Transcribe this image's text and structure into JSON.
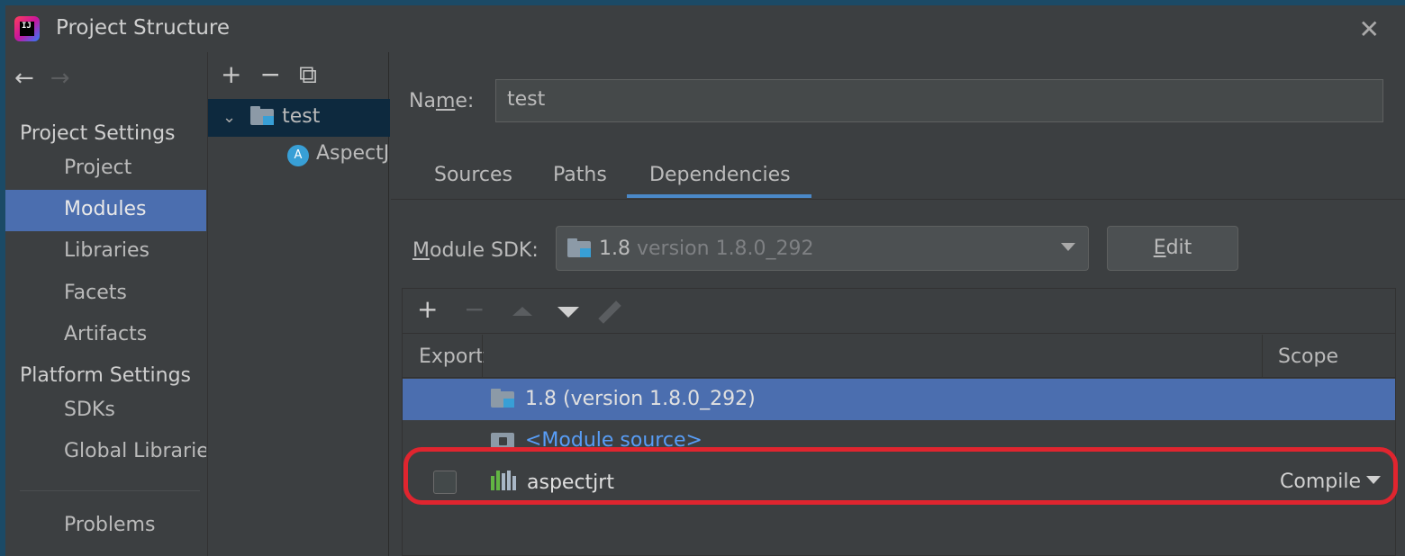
{
  "window": {
    "title": "Project Structure",
    "app_icon_text": "IJ"
  },
  "nav": {
    "project_settings_header": "Project Settings",
    "project_items": [
      "Project",
      "Modules",
      "Libraries",
      "Facets",
      "Artifacts"
    ],
    "platform_settings_header": "Platform Settings",
    "platform_items": [
      "SDKs",
      "Global Librarie"
    ],
    "problems": "Problems",
    "selected": "Modules"
  },
  "tree": {
    "root": "test",
    "child": "AspectJ"
  },
  "module": {
    "name_label": "Name:",
    "name_value": "test",
    "tabs": [
      "Sources",
      "Paths",
      "Dependencies"
    ],
    "active_tab": "Dependencies",
    "sdk_label": "Module SDK:",
    "sdk_value": "1.8",
    "sdk_version": "version 1.8.0_292",
    "edit_label": "Edit"
  },
  "dependencies": {
    "columns": {
      "export": "Export",
      "scope": "Scope"
    },
    "rows": [
      {
        "label": "1.8 (version 1.8.0_292)",
        "selected": true
      },
      {
        "label": "<Module source>",
        "link": true
      },
      {
        "label": "aspectjrt",
        "scope": "Compile",
        "exported": false
      }
    ]
  },
  "colors": {
    "selection": "#4b6eaf",
    "accent": "#4a88c7",
    "link": "#589df6",
    "highlight": "#e0252f"
  }
}
